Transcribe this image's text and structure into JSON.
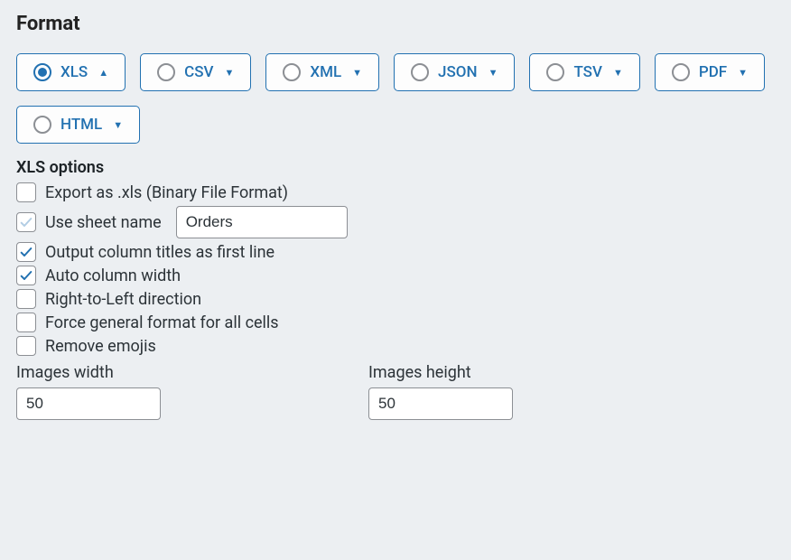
{
  "title": "Format",
  "formats": [
    {
      "id": "xls",
      "label": "XLS",
      "selected": true,
      "arrow": "up"
    },
    {
      "id": "csv",
      "label": "CSV",
      "selected": false,
      "arrow": "down"
    },
    {
      "id": "xml",
      "label": "XML",
      "selected": false,
      "arrow": "down"
    },
    {
      "id": "json",
      "label": "JSON",
      "selected": false,
      "arrow": "down"
    },
    {
      "id": "tsv",
      "label": "TSV",
      "selected": false,
      "arrow": "down"
    },
    {
      "id": "pdf",
      "label": "PDF",
      "selected": false,
      "arrow": "down"
    },
    {
      "id": "html",
      "label": "HTML",
      "selected": false,
      "arrow": "down"
    }
  ],
  "xls": {
    "section_label": "XLS options",
    "export_binary": {
      "label": "Export as .xls (Binary File Format)",
      "checked": false
    },
    "use_sheet_name": {
      "label": "Use sheet name",
      "checked": true,
      "checked_light": true,
      "value": "Orders"
    },
    "output_titles": {
      "label": "Output column titles as first line",
      "checked": true
    },
    "auto_width": {
      "label": "Auto column width",
      "checked": true
    },
    "rtl": {
      "label": "Right-to-Left direction",
      "checked": false
    },
    "force_general": {
      "label": "Force general format for all cells",
      "checked": false
    },
    "remove_emojis": {
      "label": "Remove emojis",
      "checked": false
    },
    "images_width": {
      "label": "Images width",
      "value": "50"
    },
    "images_height": {
      "label": "Images height",
      "value": "50"
    }
  }
}
